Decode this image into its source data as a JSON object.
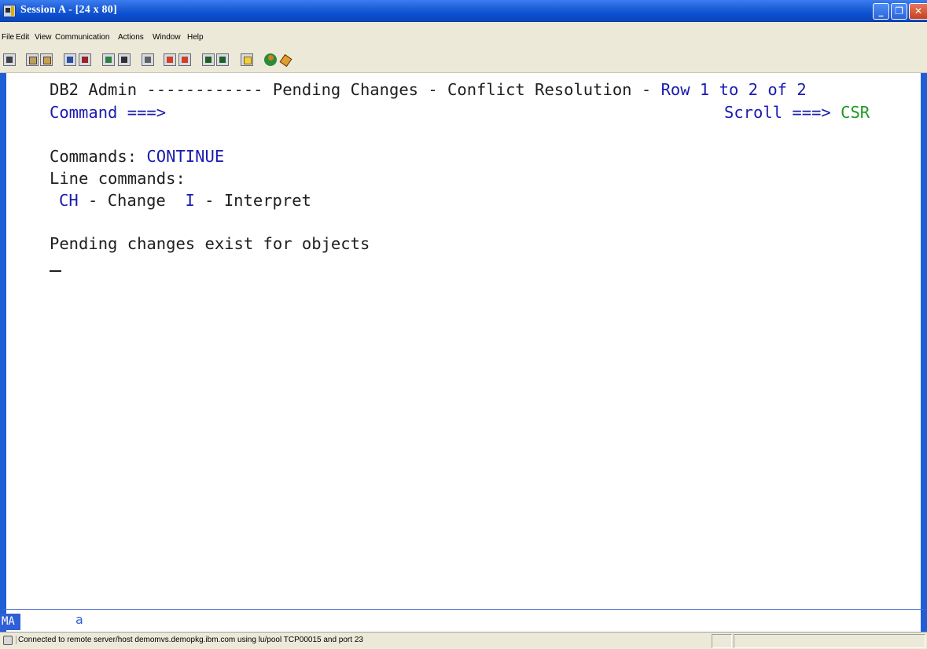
{
  "window": {
    "title": "Session A - [24 x 80]",
    "buttons": {
      "minimize": "_",
      "maximize": "❐",
      "close": "✕"
    }
  },
  "menu": {
    "items": [
      "File",
      "Edit",
      "View",
      "Communication",
      "Actions",
      "Window",
      "Help"
    ]
  },
  "toolbar": {
    "icons": [
      "print-screen-icon",
      "copy-icon",
      "paste-icon",
      "send-file-icon",
      "receive-file-icon",
      "display-keypad-icon",
      "display-screen-icon",
      "macro-icon",
      "record-macro-icon",
      "stop-record-icon",
      "play-macro-icon",
      "pause-macro-icon",
      "document-icon",
      "globe-icon",
      "tag-icon"
    ]
  },
  "terminal": {
    "header_left": "DB2 Admin ------------ Pending Changes - Conflict Resolution - ",
    "header_right": "Row 1 to 2 of 2",
    "command_label": "Command ===>",
    "scroll_label": "Scroll ===> ",
    "scroll_value": "CSR",
    "commands_label": "Commands: ",
    "commands_value": "CONTINUE",
    "line_commands_label": "Line commands:",
    "lc_ch": "CH",
    "lc_ch_desc": " - Change  ",
    "lc_i": "I",
    "lc_i_desc": " - Interpret",
    "message": "Pending changes exist for objects"
  },
  "oia": {
    "ma": "MA",
    "a": "a"
  },
  "status": {
    "text": "Connected to remote server/host demomvs.demopkg.ibm.com using lu/pool TCP00015 and port 23"
  },
  "colors": {
    "title_bar": "#1e5fd6",
    "terminal_text": "#202020",
    "terminal_blue": "#1a1ab0",
    "terminal_green": "#1c9a20"
  }
}
